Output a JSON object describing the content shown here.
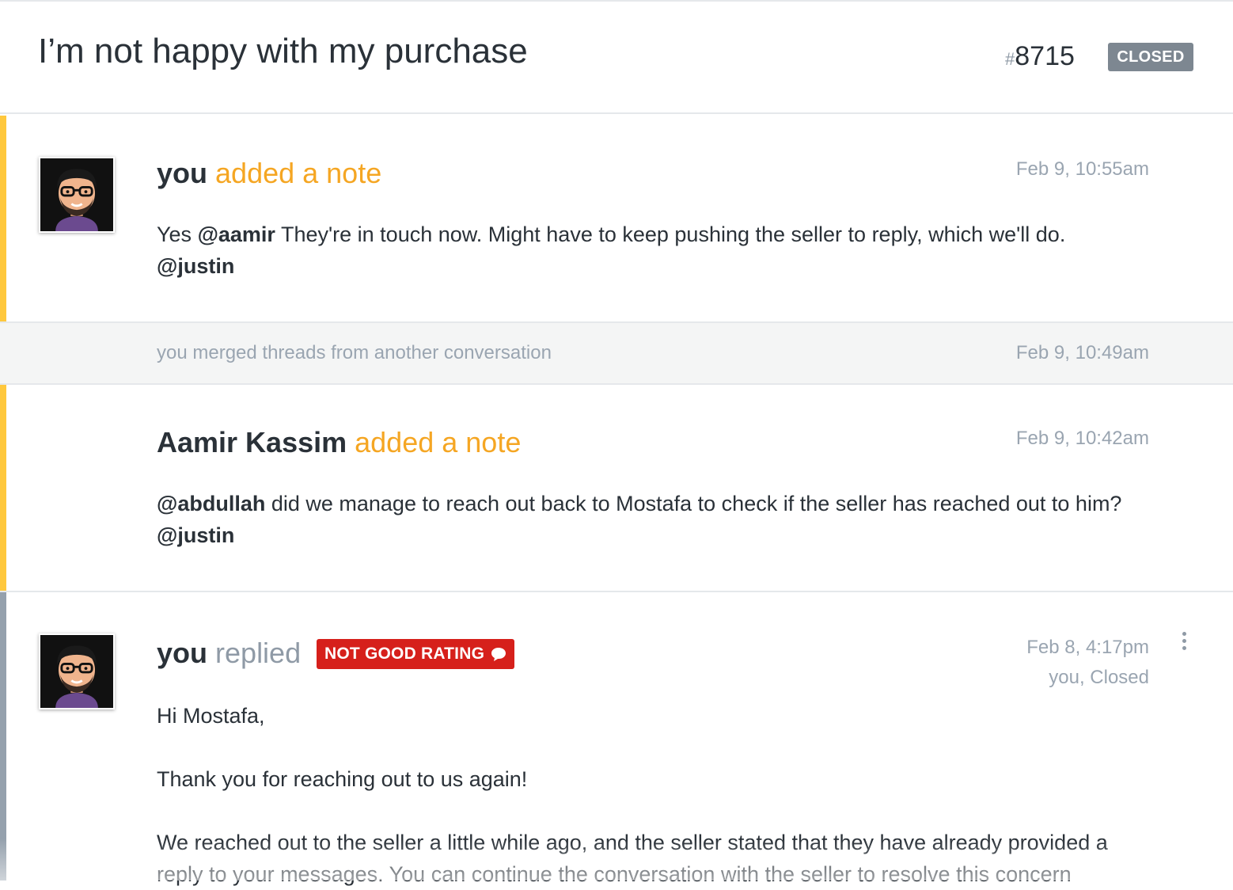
{
  "conversation": {
    "subject": "I’m not happy with my purchase",
    "hash": "#",
    "number": "8715",
    "status": "CLOSED"
  },
  "threads": [
    {
      "type": "note",
      "actor": "you",
      "action": "added a note",
      "timestamp": "Feb 9, 10:55am",
      "body": {
        "t1": "Yes ",
        "mention1": "@aamir",
        "t2": " They're in touch now. Might have to keep pushing the seller to reply, which we'll do.",
        "mention2": "@justin"
      }
    },
    {
      "type": "line-item",
      "text": "you merged threads from another conversation",
      "timestamp": "Feb 9, 10:49am"
    },
    {
      "type": "note",
      "actor": "Aamir Kassim",
      "action": "added a note",
      "timestamp": "Feb 9, 10:42am",
      "body": {
        "mention1": "@abdullah",
        "t1": " did we manage to reach out back to Mostafa to check if the seller has reached out to him? ",
        "mention2": "@justin"
      }
    },
    {
      "type": "reply",
      "actor": "you",
      "action": "replied",
      "rating_badge": "NOT GOOD RATING",
      "timestamp": "Feb 8, 4:17pm",
      "meta": "you, Closed",
      "body": {
        "p1": "Hi Mostafa,",
        "p2": "Thank you for reaching out to us again!",
        "p3": "We reached out to the seller a little while ago, and the seller stated that they have already provided a reply to your messages. You can continue the conversation with the seller to resolve this concern"
      }
    }
  ],
  "colors": {
    "note_bar": "#ffc83d",
    "reply_bar": "#95a1ad",
    "note_action": "#f5a623",
    "status_badge": "#7d8791",
    "rating_badge": "#d6201b"
  },
  "icons": {
    "avatar": "cartoon-avatar-glasses-beard",
    "rating": "speech-bubble-icon",
    "menu": "kebab-menu-icon"
  }
}
